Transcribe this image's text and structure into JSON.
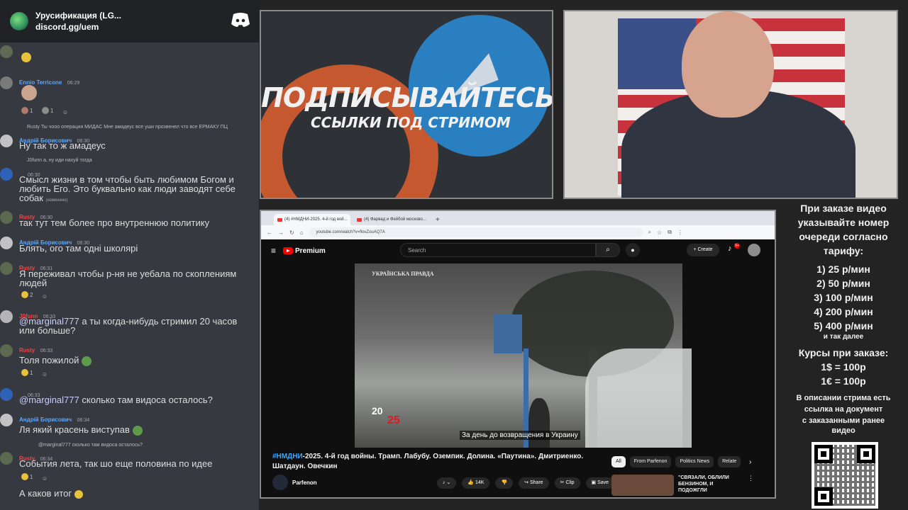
{
  "discord": {
    "server_name": "Урусификация (LG...",
    "invite": "discord.gg/uem",
    "messages": [
      {
        "name": "Ennio Terricone",
        "name_color": "#5aa8ff",
        "time": "06:29",
        "text": "",
        "reactions": [
          "1",
          "1"
        ]
      },
      {
        "reply": "Rusty Ты чооо операция МИДАС Мне амадеус все уши прозвенел что все ЕРМАКУ ПЦ",
        "name": "Андрій Борисович",
        "name_color": "#5aa8ff",
        "time": "06:30",
        "text": "Ну так то ж амадеус"
      },
      {
        "reply": "J0funn а, ну иди нахуй тогда",
        "name": "",
        "name_color": "#b9bbbe",
        "time": "06:30",
        "text": "Смысл жизни в том чтобы быть любимом Богом и любить Его. Это буквально как люди заводят себе собак",
        "edited": "(изменено)"
      },
      {
        "name": "Rusty",
        "name_color": "#f04747",
        "time": "06:30",
        "text": "так тут тем более про внутреннюю политику"
      },
      {
        "name": "Андрій Борисович",
        "name_color": "#5aa8ff",
        "time": "06:30",
        "text": "Блять, ого там одні школярі"
      },
      {
        "name": "Rusty",
        "name_color": "#f04747",
        "time": "06:31",
        "text": "Я переживал чтобы р-ня не уебала по скоплениям людей",
        "reactions": [
          "2"
        ]
      },
      {
        "name": "J0funn",
        "name_color": "#f04747",
        "time": "06:33",
        "mention": "@marginal777",
        "text": "а ты когда-нибудь стримил 20 часов или больше?"
      },
      {
        "name": "Rusty",
        "name_color": "#f04747",
        "time": "06:33",
        "text": "Толя пожилой",
        "reactions": [
          "1"
        ]
      },
      {
        "name": "",
        "name_color": "#b9bbbe",
        "time": "06:33",
        "mention": "@marginal777",
        "text": "сколько там видоса осталось?"
      },
      {
        "name": "Андрій Борисович",
        "name_color": "#5aa8ff",
        "time": "06:34",
        "text": "Ля який красень виступав"
      },
      {
        "reply": "@marginal777 сколько там видоса осталось?",
        "name": "Rusty",
        "name_color": "#f04747",
        "time": "06:34",
        "text": "События лета, так шо еще половина по идее",
        "reactions": [
          "1"
        ]
      },
      {
        "name": "",
        "name_color": "#b9bbbe",
        "time": "",
        "text": "А каков итог"
      }
    ]
  },
  "promo": {
    "title": "ПОДПИСЫВАЙТЕСЬ",
    "subtitle": "ССЫЛКИ ПОД СТРИМОМ"
  },
  "browser": {
    "tabs": [
      {
        "label": "(4) #НМДНИ-2025. 4-й год вой..."
      },
      {
        "label": "(4) Фарвад и Фейбой москово..."
      }
    ],
    "url": "youtube.com/watch?v=flovZouAQ7A",
    "youtube": {
      "logo": "Premium",
      "search_placeholder": "Search",
      "create_label": "Create",
      "notification_count": "9+",
      "video": {
        "overlay_logo": "УКРАЇНСЬКА ПРАВДА",
        "badge_top": "20",
        "badge_bottom": "25",
        "subtitle": "За день до возвращения в Украину"
      },
      "title_hashtag": "#НМДНИ",
      "title_rest": "-2025. 4-й год войны. Трамп. Лабубу. Оземпик. Долина. «Паутина». Дмитриенко. Шатдаун. Овечкин",
      "channel": "Parfenon",
      "likes": "14K",
      "share": "Share",
      "clip": "Clip",
      "save": "Save",
      "chips": [
        "All",
        "From Parfenon",
        "Politics News",
        "Relate"
      ],
      "rec_title": "\"СВЯЗАЛИ, ОБЛИЛИ БЕНЗИНОМ, И ПОДОЖГЛИ"
    }
  },
  "info": {
    "line1": "При заказе видео",
    "line2": "указывайте номер",
    "line3": "очереди согласно",
    "line4": "тарифу:",
    "tariffs": [
      "1) 25 р/мин",
      "2) 50 р/мин",
      "3) 100 р/мин",
      "4) 200 р/мин",
      "5) 400 р/мин"
    ],
    "etc": "и так далее",
    "courses_title": "Курсы при заказе:",
    "usd": "1$ = 100р",
    "eur": "1€ = 100р",
    "desc1": "В описании стрима есть",
    "desc2": "ссылка на документ",
    "desc3": "с заказанными ранее",
    "desc4": "видео"
  }
}
